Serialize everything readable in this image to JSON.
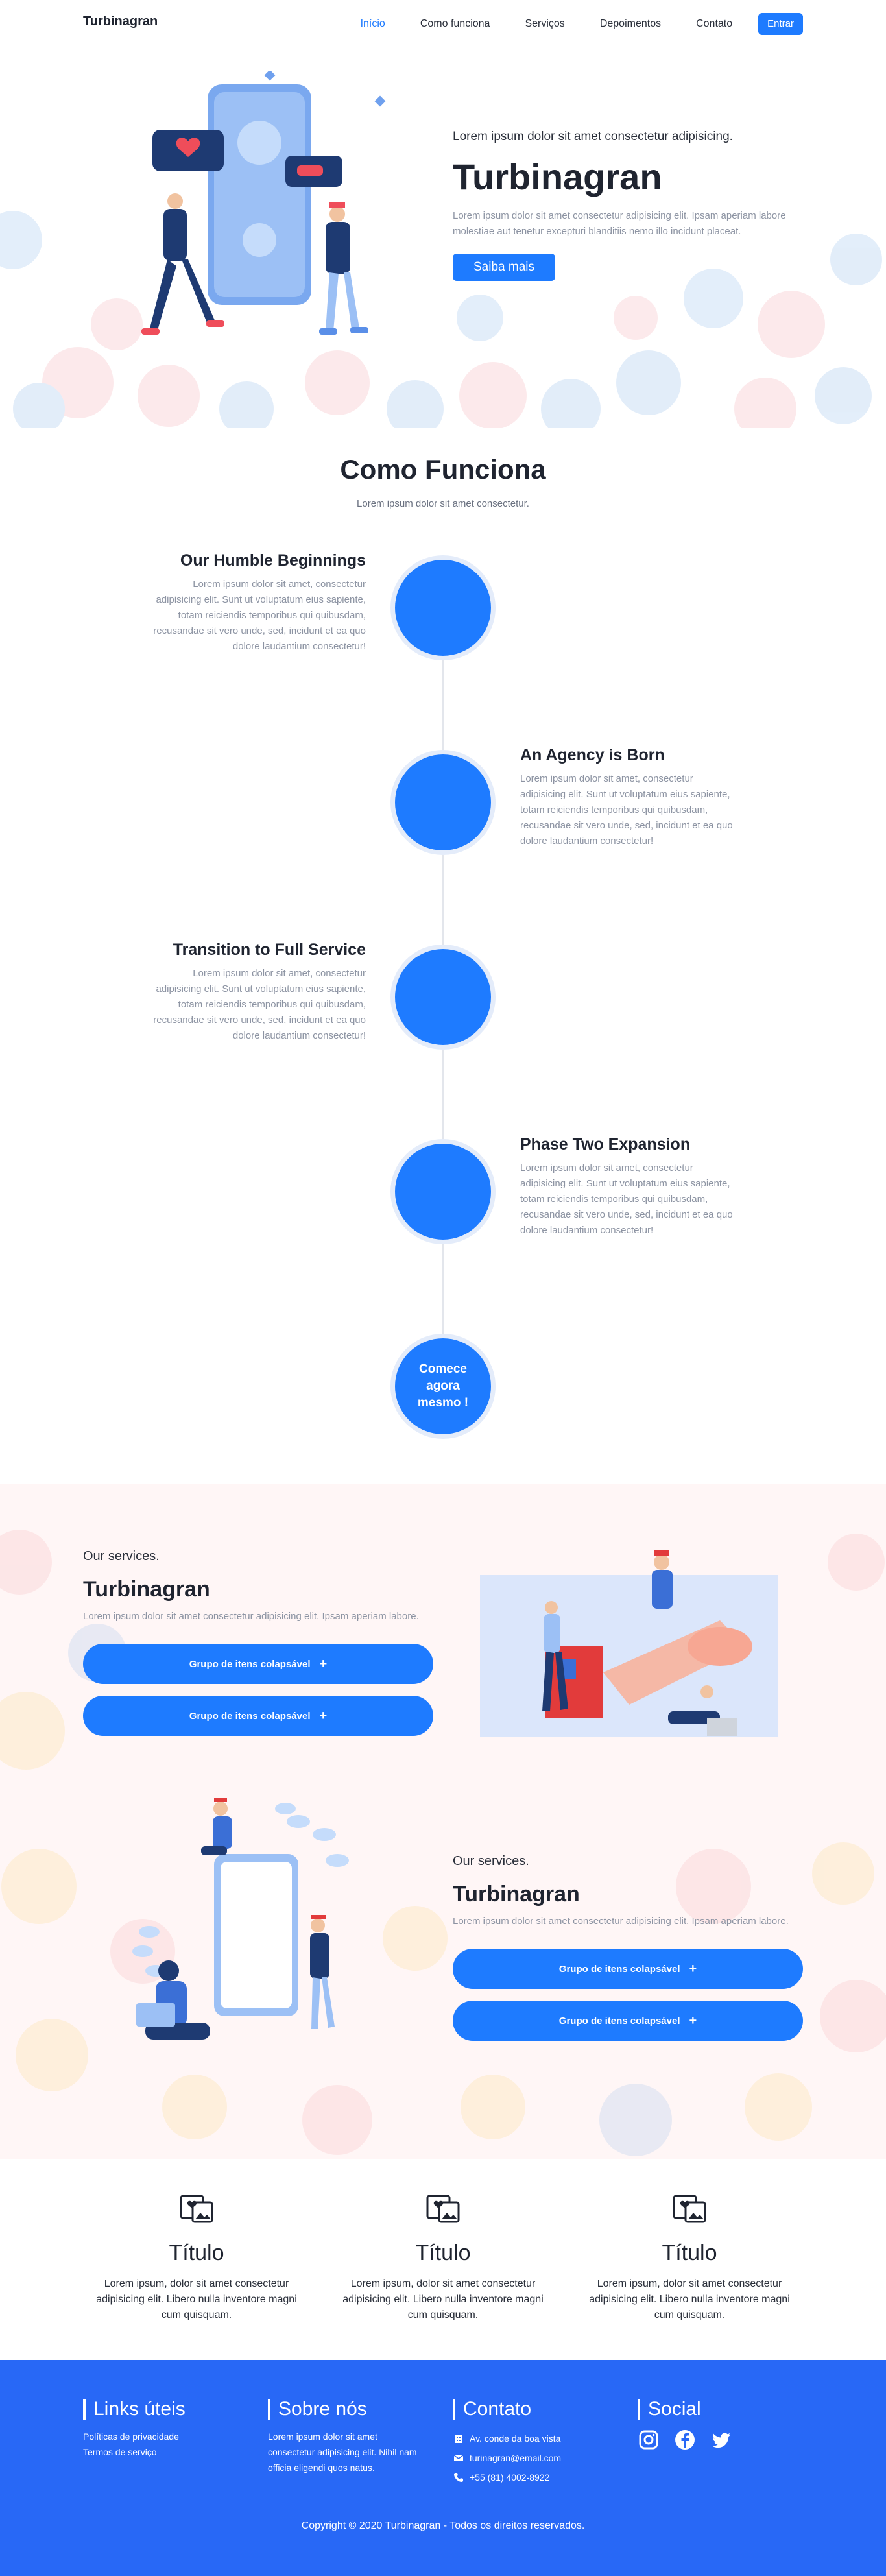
{
  "nav": {
    "brand": "Turbinagran",
    "links": [
      "Início",
      "Como funciona",
      "Serviços",
      "Depoimentos",
      "Contato"
    ],
    "login": "Entrar"
  },
  "hero": {
    "kicker": "Lorem ipsum dolor sit amet consectetur adipisicing.",
    "title": "Turbinagran",
    "description": "Lorem ipsum dolor sit amet consectetur adipisicing elit. Ipsam aperiam labore molestiae aut tenetur excepturi blanditiis nemo illo incidunt placeat.",
    "cta": "Saiba mais"
  },
  "how": {
    "title": "Como Funciona",
    "subtitle": "Lorem ipsum dolor sit amet consectetur.",
    "steps": [
      {
        "title": "Our Humble Beginnings",
        "text": "Lorem ipsum dolor sit amet, consectetur adipisicing elit. Sunt ut voluptatum eius sapiente, totam reiciendis temporibus qui quibusdam, recusandae sit vero unde, sed, incidunt et ea quo dolore laudantium consectetur!"
      },
      {
        "title": "An Agency is Born",
        "text": "Lorem ipsum dolor sit amet, consectetur adipisicing elit. Sunt ut voluptatum eius sapiente, totam reiciendis temporibus qui quibusdam, recusandae sit vero unde, sed, incidunt et ea quo dolore laudantium consectetur!"
      },
      {
        "title": "Transition to Full Service",
        "text": "Lorem ipsum dolor sit amet, consectetur adipisicing elit. Sunt ut voluptatum eius sapiente, totam reiciendis temporibus qui quibusdam, recusandae sit vero unde, sed, incidunt et ea quo dolore laudantium consectetur!"
      },
      {
        "title": "Phase Two Expansion",
        "text": "Lorem ipsum dolor sit amet, consectetur adipisicing elit. Sunt ut voluptatum eius sapiente, totam reiciendis temporibus qui quibusdam, recusandae sit vero unde, sed, incidunt et ea quo dolore laudantium consectetur!"
      }
    ],
    "final": "Comece agora mesmo !"
  },
  "services": [
    {
      "kicker": "Our services.",
      "title": "Turbinagran",
      "description": "Lorem ipsum dolor sit amet consectetur adipisicing elit. Ipsam aperiam labore.",
      "buttons": [
        "Grupo de itens colapsável",
        "Grupo de itens colapsável"
      ]
    },
    {
      "kicker": "Our services.",
      "title": "Turbinagran",
      "description": "Lorem ipsum dolor sit amet consectetur adipisicing elit. Ipsam aperiam labore.",
      "buttons": [
        "Grupo de itens colapsável",
        "Grupo de itens colapsável"
      ]
    }
  ],
  "features": [
    {
      "title": "Título",
      "text": "Lorem ipsum, dolor sit amet consectetur adipisicing elit. Libero nulla inventore magni cum quisquam."
    },
    {
      "title": "Título",
      "text": "Lorem ipsum, dolor sit amet consectetur adipisicing elit. Libero nulla inventore magni cum quisquam."
    },
    {
      "title": "Título",
      "text": "Lorem ipsum, dolor sit amet consectetur adipisicing elit. Libero nulla inventore magni cum quisquam."
    }
  ],
  "footer": {
    "links": {
      "title": "Links úteis",
      "items": [
        "Políticas de privacidade",
        "Termos de serviço"
      ]
    },
    "about": {
      "title": "Sobre nós",
      "text": "Lorem ipsum dolor sit amet consectetur adipisicing elit. Nihil nam officia eligendi quos natus."
    },
    "contact": {
      "title": "Contato",
      "address": "Av. conde da boa vista",
      "email": "turinagran@email.com",
      "phone": "+55 (81) 4002-8922"
    },
    "social": {
      "title": "Social",
      "icons": [
        "instagram-icon",
        "facebook-icon",
        "twitter-icon"
      ]
    },
    "copyright": "Copyright © 2020 Turbinagran - Todos os direitos reservados."
  },
  "colors": {
    "accent": "#1e7bff",
    "footer": "#2868f6",
    "services_bg": "#fff6f6"
  }
}
